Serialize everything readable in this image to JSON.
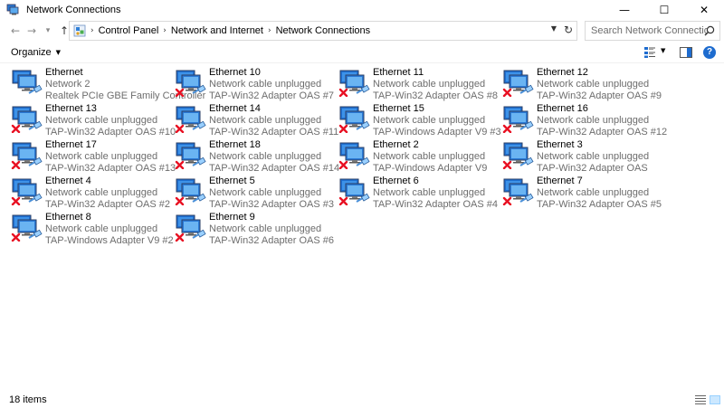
{
  "window": {
    "title": "Network Connections",
    "minimize": "—",
    "maximize": "☐",
    "close": "✕"
  },
  "nav": {
    "back": "←",
    "forward": "→",
    "recent": "⌄",
    "up": "↑"
  },
  "breadcrumb": {
    "items": [
      "Control Panel",
      "Network and Internet",
      "Network Connections"
    ]
  },
  "search": {
    "placeholder": "Search Network Connections"
  },
  "toolbar": {
    "organize_label": "Organize"
  },
  "adapters": [
    {
      "name": "Ethernet",
      "status": "Network  2",
      "device": "Realtek PCIe GBE Family Controller",
      "connected": true
    },
    {
      "name": "Ethernet 10",
      "status": "Network cable unplugged",
      "device": "TAP-Win32 Adapter OAS #7",
      "connected": false
    },
    {
      "name": "Ethernet 11",
      "status": "Network cable unplugged",
      "device": "TAP-Win32 Adapter OAS #8",
      "connected": false
    },
    {
      "name": "Ethernet 12",
      "status": "Network cable unplugged",
      "device": "TAP-Win32 Adapter OAS #9",
      "connected": false
    },
    {
      "name": "Ethernet 13",
      "status": "Network cable unplugged",
      "device": "TAP-Win32 Adapter OAS #10",
      "connected": false
    },
    {
      "name": "Ethernet 14",
      "status": "Network cable unplugged",
      "device": "TAP-Win32 Adapter OAS #11",
      "connected": false
    },
    {
      "name": "Ethernet 15",
      "status": "Network cable unplugged",
      "device": "TAP-Windows Adapter V9 #3",
      "connected": false
    },
    {
      "name": "Ethernet 16",
      "status": "Network cable unplugged",
      "device": "TAP-Win32 Adapter OAS #12",
      "connected": false
    },
    {
      "name": "Ethernet 17",
      "status": "Network cable unplugged",
      "device": "TAP-Win32 Adapter OAS #13",
      "connected": false
    },
    {
      "name": "Ethernet 18",
      "status": "Network cable unplugged",
      "device": "TAP-Win32 Adapter OAS #14",
      "connected": false
    },
    {
      "name": "Ethernet 2",
      "status": "Network cable unplugged",
      "device": "TAP-Windows Adapter V9",
      "connected": false
    },
    {
      "name": "Ethernet 3",
      "status": "Network cable unplugged",
      "device": "TAP-Win32 Adapter OAS",
      "connected": false
    },
    {
      "name": "Ethernet 4",
      "status": "Network cable unplugged",
      "device": "TAP-Win32 Adapter OAS #2",
      "connected": false
    },
    {
      "name": "Ethernet 5",
      "status": "Network cable unplugged",
      "device": "TAP-Win32 Adapter OAS #3",
      "connected": false
    },
    {
      "name": "Ethernet 6",
      "status": "Network cable unplugged",
      "device": "TAP-Win32 Adapter OAS #4",
      "connected": false
    },
    {
      "name": "Ethernet 7",
      "status": "Network cable unplugged",
      "device": "TAP-Win32 Adapter OAS #5",
      "connected": false
    },
    {
      "name": "Ethernet 8",
      "status": "Network cable unplugged",
      "device": "TAP-Windows Adapter V9 #2",
      "connected": false
    },
    {
      "name": "Ethernet 9",
      "status": "Network cable unplugged",
      "device": "TAP-Win32 Adapter OAS #6",
      "connected": false
    }
  ],
  "statusbar": {
    "count_label": "18 items"
  },
  "icons": {
    "window": "network-connections-icon",
    "adapter": "network-adapter-icon",
    "disconnected": "red-x-icon",
    "search": "search-icon",
    "help": "help-icon"
  },
  "colors": {
    "accent": "#1e6ccf",
    "error": "#e81123",
    "secondary_text": "#6d6d6d"
  }
}
